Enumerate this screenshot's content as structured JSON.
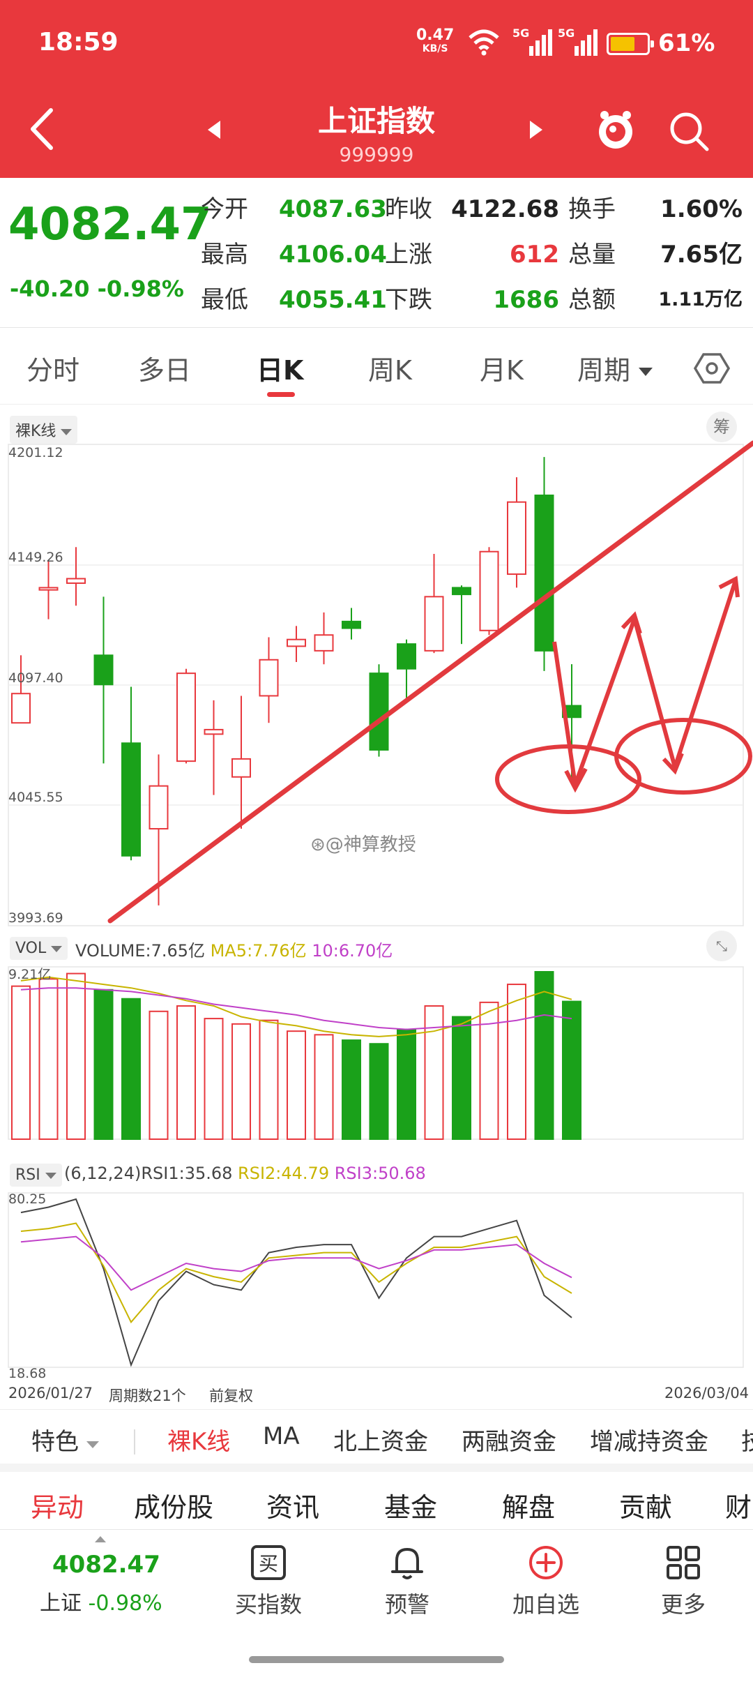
{
  "status_bar": {
    "time": "18:59",
    "net_speed": "0.47",
    "net_unit": "KB/S",
    "signal1": "5G",
    "signal2": "5G",
    "battery_pct": "61%",
    "battery_level": 0.61
  },
  "header": {
    "title": "上证指数",
    "code": "999999"
  },
  "quote": {
    "price": "4082.47",
    "change": "-40.20",
    "change_pct": "-0.98%",
    "rows": [
      {
        "l1": "今开",
        "v1": "4087.63",
        "l2": "昨收",
        "v2": "4122.68",
        "l3": "换手",
        "v3": "1.60%"
      },
      {
        "l1": "最高",
        "v1": "4106.04",
        "l2": "上涨",
        "v2": "612",
        "l3": "总量",
        "v3": "7.65亿"
      },
      {
        "l1": "最低",
        "v1": "4055.41",
        "l2": "下跌",
        "v2": "1686",
        "l3": "总额",
        "v3": "1.11万亿"
      }
    ]
  },
  "period_tabs": [
    "分时",
    "多日",
    "日K",
    "周K",
    "月K",
    "周期"
  ],
  "kline": {
    "mode_label": "裸K线",
    "chip_label": "筹",
    "y_labels": [
      "4201.12",
      "4149.26",
      "4097.40",
      "4045.55",
      "3993.69"
    ],
    "watermark": "@神算教授"
  },
  "volume": {
    "label": "VOL",
    "vol_text": "VOLUME:7.65亿",
    "ma5_text": "MA5:7.76亿",
    "ma10_text": "10:6.70亿",
    "top_label": "9.21亿"
  },
  "rsi": {
    "label": "RSI",
    "params": "(6,12,24)",
    "rsi1": "RSI1:35.68",
    "rsi2": "RSI2:44.79",
    "rsi3": "RSI3:50.68",
    "top_label": "80.25",
    "bottom_label": "18.68"
  },
  "axis_footer": {
    "start_date": "2026/01/27",
    "period_count": "周期数21个",
    "adjust": "前复权",
    "end_date": "2026/03/04"
  },
  "indicator_tabs": [
    "特色",
    "裸K线",
    "MA",
    "北上资金",
    "两融资金",
    "增减持资金",
    "技"
  ],
  "info_tabs": [
    "异动",
    "成份股",
    "资讯",
    "基金",
    "解盘",
    "贡献",
    "财"
  ],
  "bottom_bar": {
    "price": "4082.47",
    "index_name": "上证",
    "index_pct": "-0.98%",
    "items": [
      "买指数",
      "预警",
      "加自选",
      "更多"
    ],
    "buy_glyph": "买"
  },
  "chart_data": {
    "type": "candlestick",
    "ylim": [
      3993.69,
      4201.12
    ],
    "candles": [
      {
        "o": 4080,
        "c": 4093,
        "h": 4110,
        "l": 4090,
        "up": true
      },
      {
        "o": 4139,
        "c": 4140,
        "h": 4152,
        "l": 4126,
        "up": true
      },
      {
        "o": 4142,
        "c": 4144,
        "h": 4158,
        "l": 4132,
        "up": true
      },
      {
        "o": 4110,
        "c": 4097,
        "h": 4136,
        "l": 4062,
        "up": false
      },
      {
        "o": 4071,
        "c": 4021,
        "h": 4096,
        "l": 4019,
        "up": false
      },
      {
        "o": 4033,
        "c": 4052,
        "h": 4066,
        "l": 3999,
        "up": true
      },
      {
        "o": 4063,
        "c": 4102,
        "h": 4104,
        "l": 4062,
        "up": true
      },
      {
        "o": 4075,
        "c": 4077,
        "h": 4090,
        "l": 4048,
        "up": true
      },
      {
        "o": 4056,
        "c": 4064,
        "h": 4092,
        "l": 4033,
        "up": true
      },
      {
        "o": 4092,
        "c": 4108,
        "h": 4118,
        "l": 4080,
        "up": true
      },
      {
        "o": 4114,
        "c": 4117,
        "h": 4123,
        "l": 4107,
        "up": true
      },
      {
        "o": 4112,
        "c": 4119,
        "h": 4129,
        "l": 4106,
        "up": true
      },
      {
        "o": 4125,
        "c": 4122,
        "h": 4131,
        "l": 4117,
        "up": false
      },
      {
        "o": 4102,
        "c": 4068,
        "h": 4106,
        "l": 4065,
        "up": false
      },
      {
        "o": 4115,
        "c": 4104,
        "h": 4117,
        "l": 4091,
        "up": false
      },
      {
        "o": 4112,
        "c": 4136,
        "h": 4155,
        "l": 4111,
        "up": true
      },
      {
        "o": 4140,
        "c": 4137,
        "h": 4141,
        "l": 4115,
        "up": false
      },
      {
        "o": 4121,
        "c": 4156,
        "h": 4158,
        "l": 4119,
        "up": true
      },
      {
        "o": 4146,
        "c": 4178,
        "h": 4189,
        "l": 4140,
        "up": true
      },
      {
        "o": 4181,
        "c": 4112,
        "h": 4198,
        "l": 4103,
        "up": false
      },
      {
        "o": 4087.63,
        "c": 4082.47,
        "h": 4106.04,
        "l": 4055.41,
        "up": false
      }
    ],
    "volumes": [
      8.5,
      8.9,
      9.2,
      8.3,
      7.8,
      7.1,
      7.4,
      6.7,
      6.4,
      6.6,
      6.0,
      5.8,
      5.5,
      5.3,
      6.1,
      7.4,
      6.8,
      7.6,
      8.6,
      9.3,
      7.65
    ],
    "ma5": [
      8.8,
      9.0,
      8.8,
      8.6,
      8.4,
      8.1,
      7.7,
      7.4,
      6.8,
      6.5,
      6.3,
      6.0,
      5.8,
      5.7,
      5.8,
      6.0,
      6.4,
      7.1,
      7.7,
      8.2,
      7.76
    ],
    "ma10": [
      8.3,
      8.4,
      8.4,
      8.3,
      8.2,
      8.0,
      7.8,
      7.5,
      7.3,
      7.1,
      6.9,
      6.6,
      6.4,
      6.2,
      6.1,
      6.2,
      6.3,
      6.4,
      6.6,
      6.9,
      6.7
    ],
    "rsi_ylim": [
      18.68,
      80.25
    ],
    "rsi1": [
      75,
      77,
      80,
      54,
      18,
      42,
      53,
      48,
      46,
      60,
      62,
      63,
      63,
      43,
      58,
      66,
      66,
      69,
      72,
      44,
      35.68
    ],
    "rsi2": [
      68,
      69,
      71,
      55,
      34,
      46,
      54,
      51,
      49,
      58,
      59,
      60,
      60,
      49,
      56,
      62,
      62,
      64,
      66,
      51,
      44.79
    ],
    "rsi3": [
      64,
      65,
      66,
      58,
      46,
      51,
      56,
      54,
      53,
      57,
      58,
      58,
      58,
      54,
      57,
      61,
      61,
      62,
      63,
      56,
      50.68
    ],
    "colors": {
      "up": "#e8383d",
      "down": "#1aa11a",
      "ma5": "#c8b400",
      "ma10": "#c040c8",
      "rsi1": "#444444"
    }
  }
}
